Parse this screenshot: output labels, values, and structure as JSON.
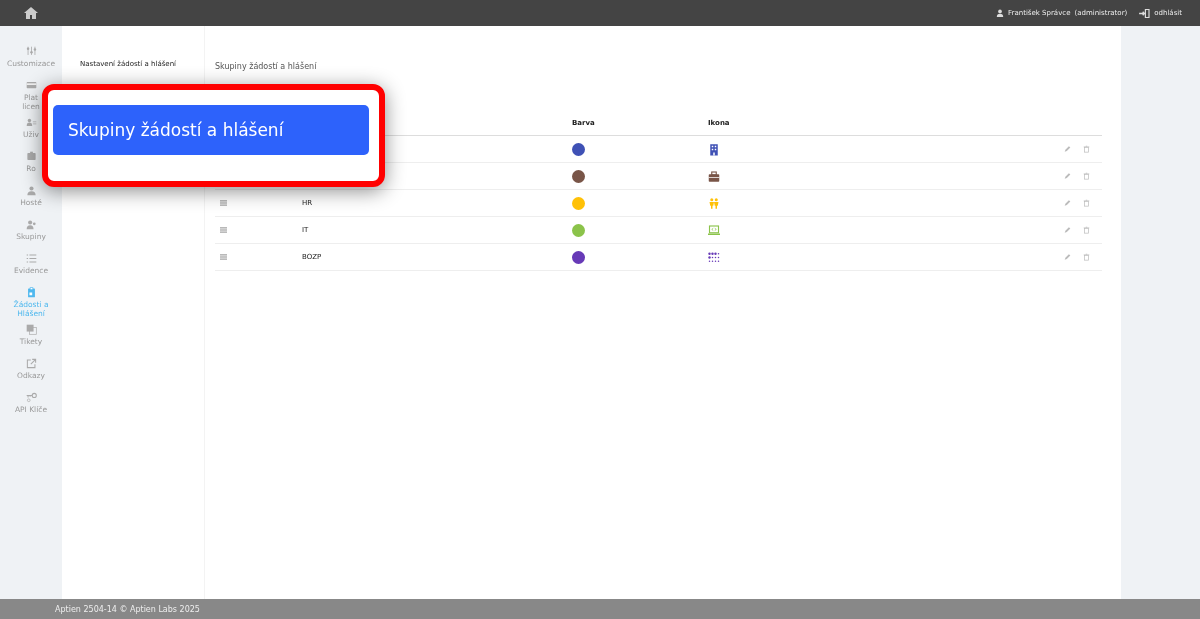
{
  "topbar": {
    "user": "František Správce",
    "role": "(administrator)",
    "logout": "odhlásit"
  },
  "sidebar": {
    "items": [
      {
        "label": "Customizace",
        "selected": false
      },
      {
        "label": "Plat\nlicen",
        "selected": false
      },
      {
        "label": "Uživ",
        "selected": false
      },
      {
        "label": "Ro",
        "selected": false
      },
      {
        "label": "Hosté",
        "selected": false
      },
      {
        "label": "Skupiny",
        "selected": false
      },
      {
        "label": "Evidence",
        "selected": false
      },
      {
        "label": "Žádosti a Hlášení",
        "selected": true
      },
      {
        "label": "Tikety",
        "selected": false
      },
      {
        "label": "Odkazy",
        "selected": false
      },
      {
        "label": "API Klíče",
        "selected": false
      }
    ]
  },
  "settings_nav": {
    "items": [
      "Nastavení žádostí a hlášení"
    ]
  },
  "page_title": "Skupiny žádostí a hlášení",
  "table": {
    "columns": [
      "Barva",
      "Ikona"
    ],
    "rows": [
      {
        "color": "#3f51b5"
      },
      {
        "color": "#795548"
      },
      {
        "name": "HR",
        "color": "#ffc107"
      },
      {
        "name": "IT",
        "color": "#8bc34a"
      },
      {
        "name": "BOZP",
        "color": "#673ab7"
      }
    ]
  },
  "callout": {
    "text": "Skupiny žádostí a hlášení"
  },
  "footer": "Aptien 2504-14 © Aptien Labs 2025"
}
